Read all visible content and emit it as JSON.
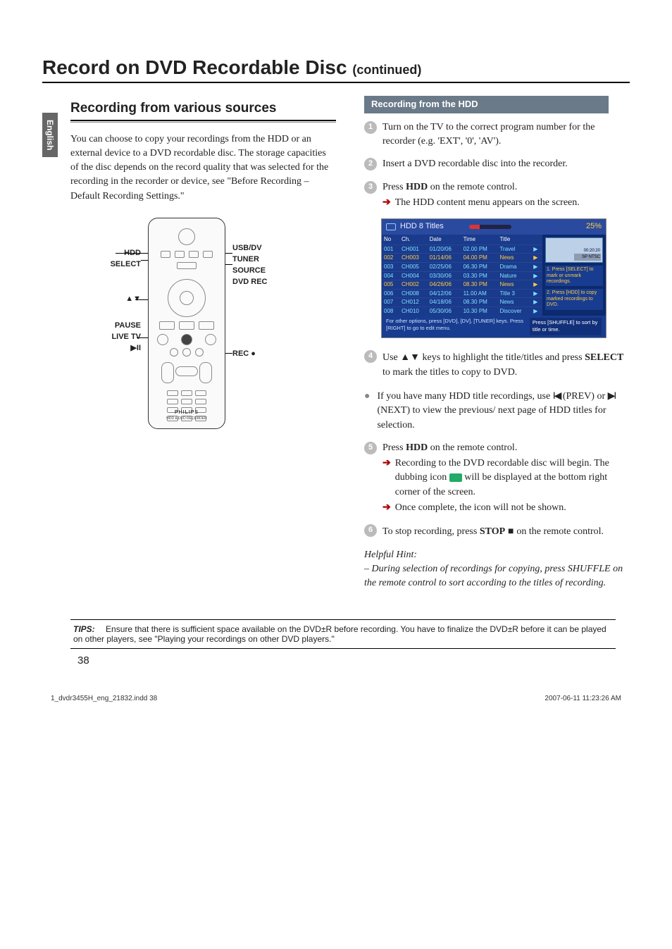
{
  "lang_tab": "English",
  "title_main": "Record on DVD Recordable Disc ",
  "title_cont": "(continued)",
  "section_heading": "Recording from various sources",
  "intro_para": "You can choose to copy your recordings from the HDD or an external device to a DVD recordable disc. The storage capacities of the disc depends on the record quality that was selected for the recording in the recorder or device, see \"Before Recording – Default Recording Settings.\"",
  "remote": {
    "callouts": {
      "hdd": "HDD",
      "select": "SELECT",
      "up_down": "▲▼",
      "pause": "PAUSE",
      "live_tv": "LIVE TV",
      "play_pause": "▶II",
      "usb_dv": "USB/DV",
      "tuner": "TUNER",
      "source": "SOURCE",
      "dvd_rec": "DVD REC",
      "rec": "REC ●"
    },
    "brand_line1": "PHILIPS",
    "brand_line2": "HDD & DVD RECORDER"
  },
  "right": {
    "subheading": "Recording from the HDD",
    "step1": "Turn on the TV to the correct program number for the recorder (e.g. 'EXT', '0', 'AV').",
    "step2": "Insert a DVD recordable disc into the recorder.",
    "step3_a": "Press ",
    "step3_b": "HDD",
    "step3_c": " on the remote control.",
    "step3_arrow": "The HDD content menu appears on the screen.",
    "hdd_screen": {
      "title": "HDD 8 Titles",
      "percent": "25%",
      "cols": [
        "No",
        "Ch.",
        "Date",
        "Time",
        "Title"
      ],
      "rows": [
        {
          "no": "001",
          "ch": "CH001",
          "date": "01/20/06",
          "time": "02.00 PM",
          "title": "Travel",
          "sel": false
        },
        {
          "no": "002",
          "ch": "CH003",
          "date": "01/14/06",
          "time": "04.00 PM",
          "title": "News",
          "sel": true
        },
        {
          "no": "003",
          "ch": "CH005",
          "date": "02/25/06",
          "time": "06.30 PM",
          "title": "Drama",
          "sel": false
        },
        {
          "no": "004",
          "ch": "CH004",
          "date": "03/30/06",
          "time": "03.30 PM",
          "title": "Nature",
          "sel": false
        },
        {
          "no": "005",
          "ch": "CH002",
          "date": "04/26/06",
          "time": "08.30 PM",
          "title": "News",
          "sel": true
        },
        {
          "no": "006",
          "ch": "CH008",
          "date": "04/12/06",
          "time": "11.00 AM",
          "title": "Title 3",
          "sel": false
        },
        {
          "no": "007",
          "ch": "CH012",
          "date": "04/18/06",
          "time": "08.30 PM",
          "title": "News",
          "sel": false
        },
        {
          "no": "008",
          "ch": "CH010",
          "date": "05/30/06",
          "time": "10.30 PM",
          "title": "Discover",
          "sel": false
        }
      ],
      "thumb_time": "00:20:20",
      "thumb_mode": "SP NTSC",
      "side1": "1. Press [SELECT] to mark or unmark recordings.",
      "side2": "2. Press [HDD] to copy marked recordings to DVD.",
      "footer_left": "For other options, press [DVD], [DV], [TUNER] keys. Press [RIGHT] to go to edit menu.",
      "footer_right": "Press [SHUFFLE] to sort by title or time."
    },
    "step4_a": "Use ",
    "step4_keys": "▲▼",
    "step4_b": " keys to highlight the title/titles and press ",
    "step4_c": "SELECT",
    "step4_d": " to mark the titles to copy to DVD.",
    "bullet_a": "If you have many HDD title recordings, use ",
    "bullet_prev": "◂",
    "bullet_prev_label": " (PREV) or ",
    "bullet_next": "▸",
    "bullet_next_label": " (NEXT) to view the previous/ next page of HDD titles for selection.",
    "step5_a": "Press ",
    "step5_b": "HDD",
    "step5_c": " on the remote control.",
    "step5_arrow1_a": "Recording to the DVD recordable disc will begin. The dubbing icon ",
    "step5_arrow1_b": " will be displayed at the bottom right corner of the screen.",
    "step5_arrow2": "Once complete, the icon will not be shown.",
    "step6_a": "To stop recording, press ",
    "step6_b": "STOP",
    "step6_sym": " ■ ",
    "step6_c": " on the remote control.",
    "hint_head": "Helpful Hint:",
    "hint_body": "– During selection of recordings for copying, press SHUFFLE on the remote control to sort according to the titles of recording."
  },
  "tips": {
    "label": "TIPS:",
    "text": "Ensure that there is sufficient space available on the DVD±R before recording. You have to finalize the DVD±R before it can be played on other players, see \"Playing your recordings on other DVD players.\""
  },
  "page_number": "38",
  "footer_file": "1_dvdr3455H_eng_21832.indd   38",
  "footer_date": "2007-06-11   11:23:26 AM"
}
